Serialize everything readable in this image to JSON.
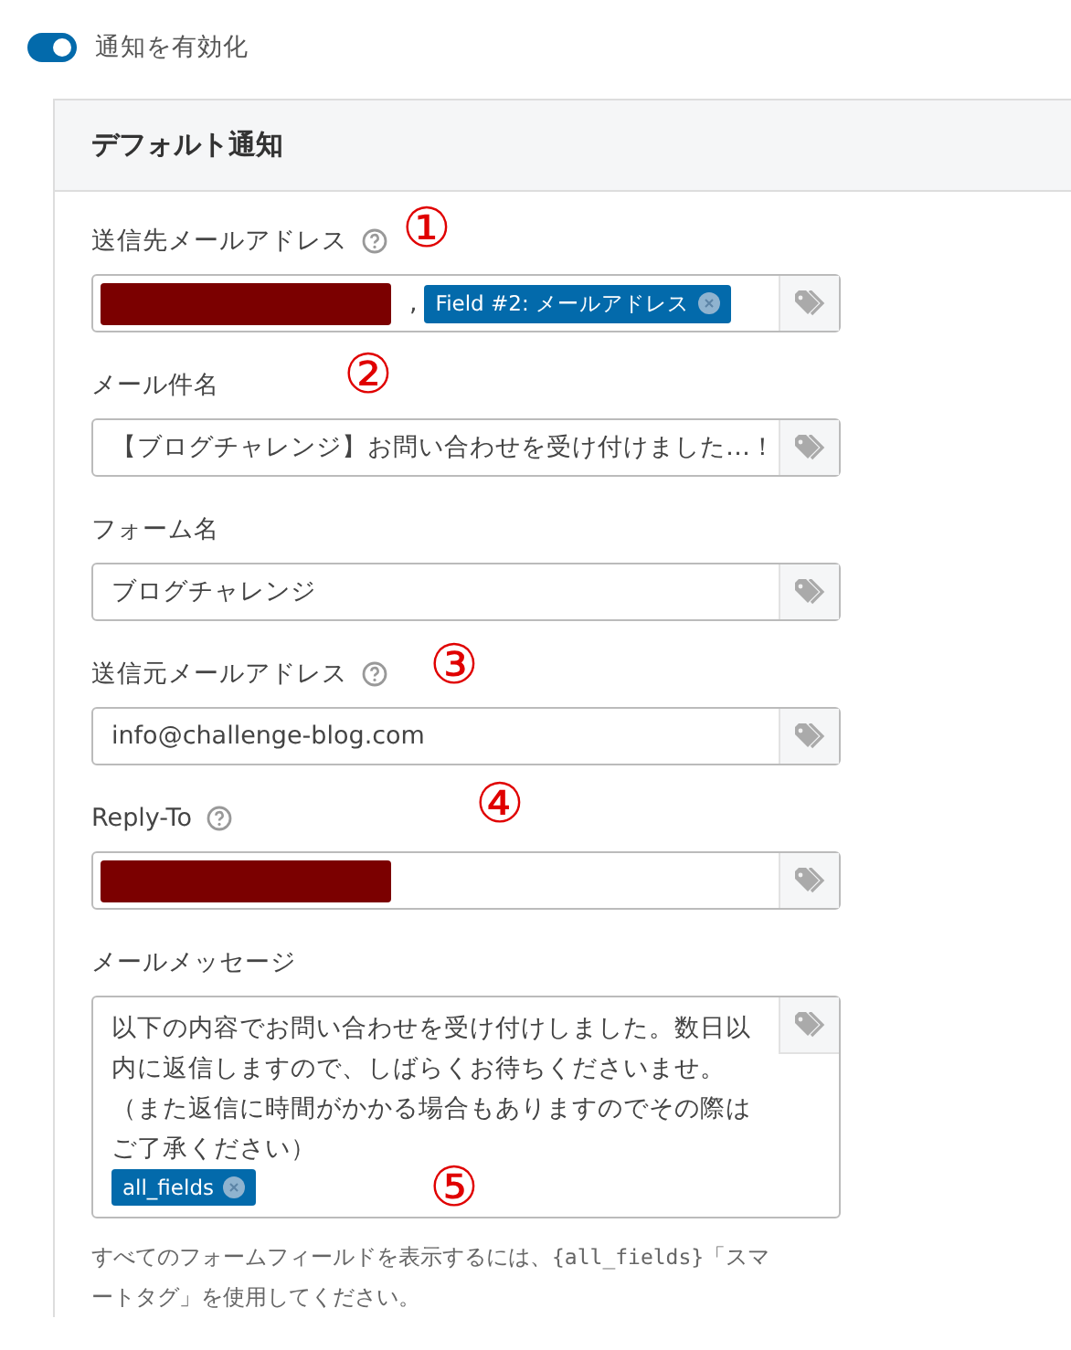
{
  "toggle": {
    "label": "通知を有効化",
    "on": true
  },
  "panel": {
    "title": "デフォルト通知",
    "fields": [
      {
        "label": "送信先メールアドレス",
        "help": true,
        "annotation": "①",
        "kind": "input",
        "tokens": [
          {
            "kind": "redacted"
          },
          {
            "kind": "text",
            "text": ","
          },
          {
            "kind": "tag",
            "text": "Field #2: メールアドレス"
          }
        ]
      },
      {
        "label": "メール件名",
        "help": false,
        "annotation": "②",
        "kind": "input",
        "tokens": [
          {
            "kind": "text",
            "text": "【ブログチャレンジ】お問い合わせを受け付けました…！"
          }
        ]
      },
      {
        "label": "フォーム名",
        "help": false,
        "kind": "input",
        "tokens": [
          {
            "kind": "text",
            "text": "ブログチャレンジ"
          }
        ]
      },
      {
        "label": "送信元メールアドレス",
        "help": true,
        "annotation": "③",
        "kind": "input",
        "tokens": [
          {
            "kind": "text",
            "text": "info@challenge-blog.com"
          }
        ]
      },
      {
        "label": "Reply-To",
        "help": true,
        "annotation": "④",
        "kind": "input",
        "tokens": [
          {
            "kind": "redacted"
          }
        ]
      },
      {
        "label": "メールメッセージ",
        "help": false,
        "annotation": "⑤",
        "kind": "textarea",
        "tokens": [
          {
            "kind": "text",
            "text": "以下の内容でお問い合わせを受け付けしました。数日以内に返信しますので、しばらくお待ちくださいませ。（また返信に時間がかかる場合もありますのでその際はご了承ください）"
          },
          {
            "kind": "tag",
            "text": "all_fields"
          }
        ],
        "hint": [
          {
            "kind": "text",
            "text": "すべてのフォームフィールドを表示するには、"
          },
          {
            "kind": "code",
            "text": "{all_fields}"
          },
          {
            "kind": "text",
            "text": "「スマートタグ」を使用してください。"
          }
        ]
      }
    ]
  }
}
